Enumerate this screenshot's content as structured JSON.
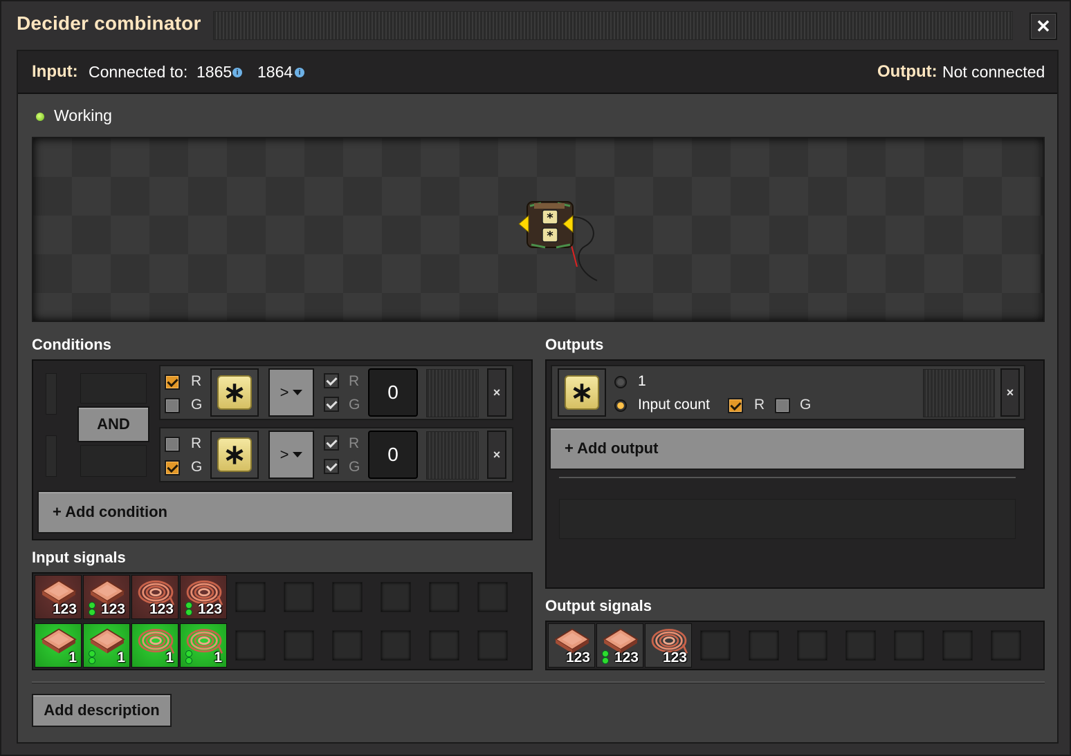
{
  "window": {
    "title": "Decider combinator",
    "close_glyph": "✕"
  },
  "connections": {
    "input_label": "Input:",
    "connected_to_label": "Connected to:",
    "red_network_id": "1865",
    "green_network_id": "1864",
    "info_glyph": "i",
    "output_label": "Output:",
    "output_value": "Not connected"
  },
  "status": {
    "text": "Working",
    "color": "#8ee02a"
  },
  "conditions": {
    "title": "Conditions",
    "logic_operator": "AND",
    "rows": [
      {
        "left_red_checked": true,
        "left_green_checked": false,
        "left_r_label": "R",
        "left_g_label": "G",
        "signal_icon": "signal-everything-icon",
        "signal_glyph": "∗",
        "comparator": ">",
        "right_red_checked": true,
        "right_green_checked": true,
        "right_r_label": "R",
        "right_g_label": "G",
        "constant": "0",
        "remove_glyph": "×"
      },
      {
        "left_red_checked": false,
        "left_green_checked": true,
        "left_r_label": "R",
        "left_g_label": "G",
        "signal_icon": "signal-everything-icon",
        "signal_glyph": "∗",
        "comparator": ">",
        "right_red_checked": true,
        "right_green_checked": true,
        "right_r_label": "R",
        "right_g_label": "G",
        "constant": "0",
        "remove_glyph": "×"
      }
    ],
    "add_label": "+ Add condition"
  },
  "outputs": {
    "title": "Outputs",
    "rows": [
      {
        "signal_icon": "signal-everything-icon",
        "signal_glyph": "∗",
        "option_constant_label": "1",
        "option_constant_selected": false,
        "option_input_count_label": "Input count",
        "option_input_count_selected": true,
        "red_checked": true,
        "green_checked": false,
        "r_label": "R",
        "g_label": "G",
        "remove_glyph": "×"
      }
    ],
    "add_label": "+ Add output"
  },
  "input_signals": {
    "title": "Input signals",
    "red_row": [
      {
        "icon": "copper-plate-icon",
        "count": "123",
        "chained": false
      },
      {
        "icon": "copper-plate-icon",
        "count": "123",
        "chained": true
      },
      {
        "icon": "copper-cable-icon",
        "count": "123",
        "chained": false
      },
      {
        "icon": "copper-cable-icon",
        "count": "123",
        "chained": true
      }
    ],
    "green_row": [
      {
        "icon": "copper-plate-icon",
        "count": "1",
        "chained": false
      },
      {
        "icon": "copper-plate-icon",
        "count": "1",
        "chained": true
      },
      {
        "icon": "copper-cable-icon",
        "count": "1",
        "chained": false
      },
      {
        "icon": "copper-cable-icon",
        "count": "1",
        "chained": true
      }
    ]
  },
  "output_signals": {
    "title": "Output signals",
    "items": [
      {
        "icon": "copper-plate-icon",
        "count": "123",
        "chained": false
      },
      {
        "icon": "copper-plate-icon",
        "count": "123",
        "chained": true
      },
      {
        "icon": "copper-cable-icon",
        "count": "123",
        "chained": false
      }
    ]
  },
  "description": {
    "button_label": "Add description"
  },
  "colors": {
    "title_gold": "#ffe6c0",
    "red_wire": "#e84040",
    "green_wire": "#3ec43e",
    "checkbox_orange": "#e39827",
    "button_gray": "#8e8e8e",
    "signal_yellow": "#e8d888"
  }
}
